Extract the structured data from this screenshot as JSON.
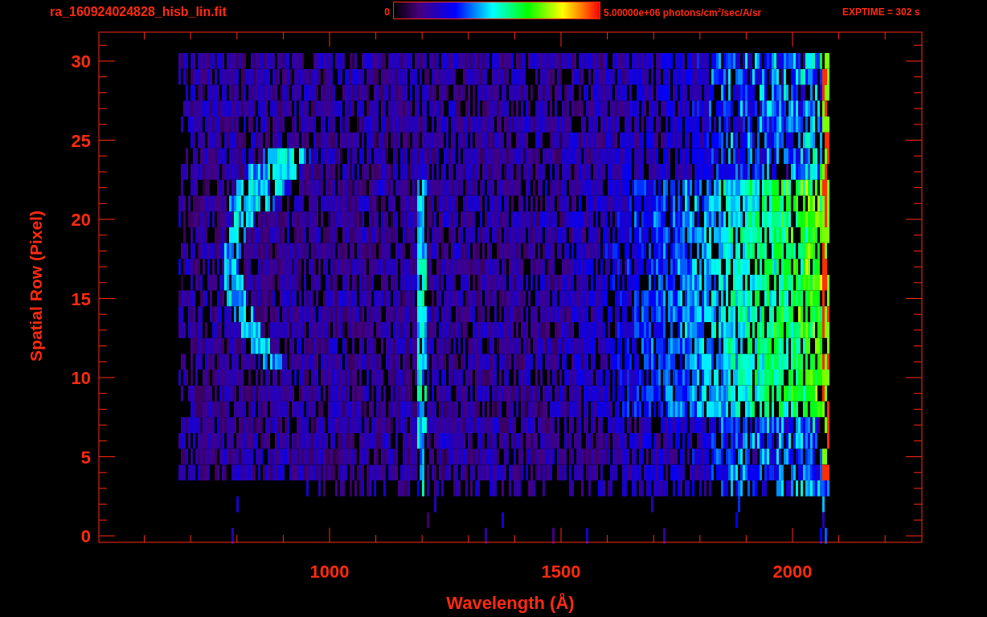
{
  "header": {
    "filename": "ra_160924024828_hisb_lin.fit",
    "colorbar": {
      "min_label": "0",
      "max_label": "5.00000e+06 photons/cm$^{2}$/sec/A/sr"
    },
    "exposure": "EXPTIME = 302 s"
  },
  "plot": {
    "ylabel": "Spatial Row (Pixel)",
    "xlabel": "Wavelength (Å)",
    "xticks": [
      "1000",
      "1500",
      "2000"
    ],
    "yticks": [
      "30",
      "25",
      "20",
      "15",
      "10",
      "5",
      "0"
    ]
  }
}
